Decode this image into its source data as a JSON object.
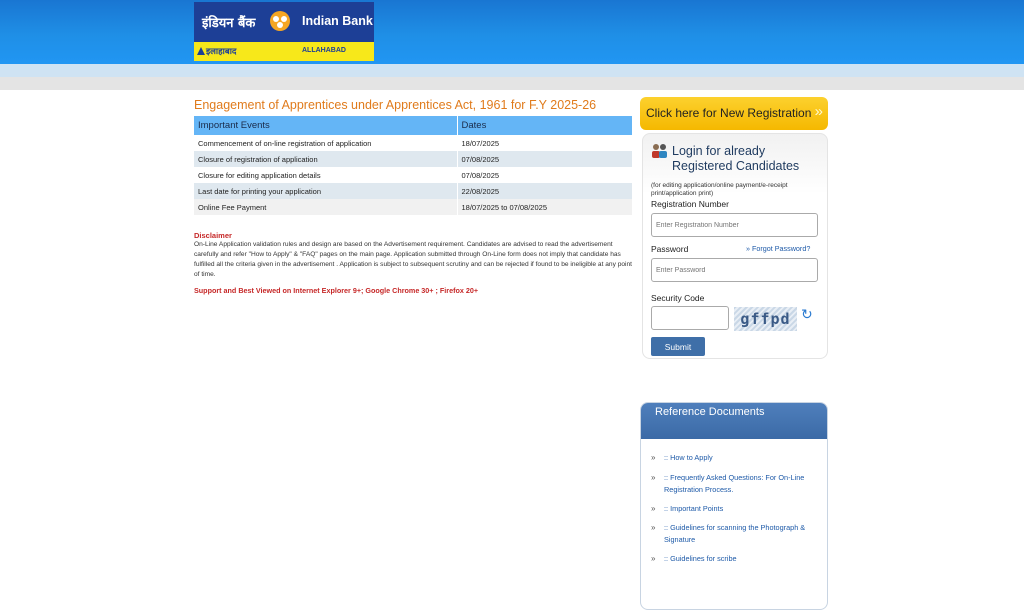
{
  "header": {
    "logo_hindi": "इंडियन बैंक",
    "logo_english": "Indian Bank",
    "logo_allahabad_hindi": "इलाहाबाद",
    "logo_allahabad_english": "ALLAHABAD"
  },
  "main": {
    "title": "Engagement of Apprentices under Apprentices Act, 1961 for F.Y 2025-26",
    "table": {
      "headers": [
        "Important Events",
        "Dates"
      ],
      "rows": [
        [
          "Commencement of on-line registration of application",
          "18/07/2025"
        ],
        [
          "Closure of registration of application",
          "07/08/2025"
        ],
        [
          "Closure for editing application details",
          "07/08/2025"
        ],
        [
          "Last date for printing your application",
          "22/08/2025"
        ],
        [
          "Online Fee Payment",
          "18/07/2025 to 07/08/2025"
        ]
      ]
    },
    "disclaimer_title": "Disclaimer",
    "disclaimer_text": "On-Line Application validation rules and design are based on the Advertisement requirement. Candidates are advised to read the advertisement carefully and refer \"How to Apply\" & \"FAQ\" pages on the main page. Application submitted through On-Line form does not imply that candidate has fulfilled all the criteria given in the advertisement . Application is subject to subsequent scrutiny and can be rejected if found to be ineligible at any point of time.",
    "support_text": "Support and Best Viewed on Internet Explorer 9+; Google Chrome 30+ ; Firefox 20+"
  },
  "new_registration": {
    "label": "Click here for New Registration",
    "chevron": "»"
  },
  "login": {
    "title": "Login for already Registered Candidates",
    "subtitle": "(for editing application/online payment/e-receipt print/application print)",
    "registration_label": "Registration Number",
    "registration_placeholder": "Enter Registration Number",
    "password_label": "Password",
    "password_placeholder": "Enter Password",
    "forgot_label": "»  Forgot Password?",
    "security_label": "Security Code",
    "captcha_text": "gffpd",
    "submit_label": "Submit"
  },
  "reference": {
    "title": "Reference Documents",
    "bullet": "»",
    "items": [
      ":: How to Apply",
      ":: Frequently Asked Questions: For On-Line Registration Process.",
      ":: Important Points",
      ":: Guidelines for scanning the Photograph & Signature",
      ":: Guidelines for scribe"
    ]
  },
  "colors": {
    "header_blue": "#1f8fe6",
    "title_orange": "#e07b1c",
    "table_header": "#64b5f6",
    "disclaimer_red": "#c62828",
    "button_yellow": "#fcd12e",
    "submit_blue": "#3f6fa8"
  }
}
